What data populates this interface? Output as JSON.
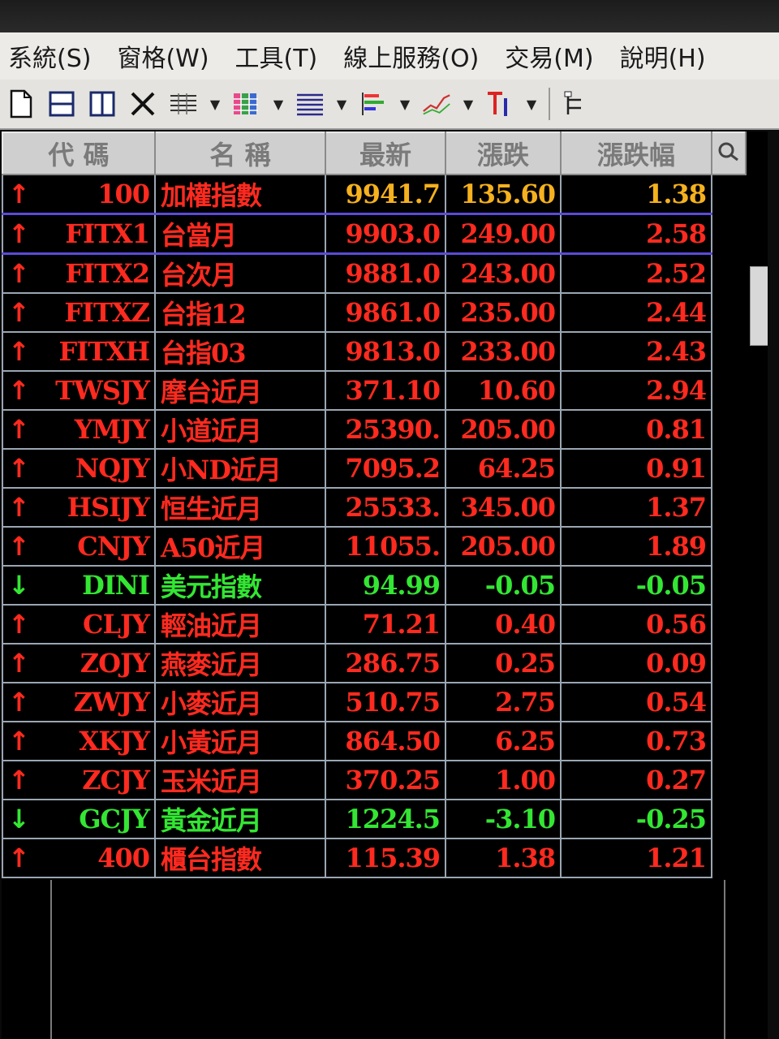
{
  "menu": [
    "系統(S)",
    "窗格(W)",
    "工具(T)",
    "線上服務(O)",
    "交易(M)",
    "說明(H)"
  ],
  "toolbar": {
    "buttons": [
      "new-doc-icon",
      "split-horizontal-icon",
      "split-vertical-icon",
      "close-x-icon",
      "table-grid-icon",
      "color-columns-icon",
      "list-rows-icon",
      "bar-chart-icon",
      "line-chart-icon",
      "text-format-icon",
      "tree-icon"
    ]
  },
  "table": {
    "headers": [
      "代 碼",
      "名 稱",
      "最新",
      "漲跌",
      "漲跌幅"
    ],
    "rows": [
      {
        "dir": "↑",
        "code": "100",
        "name": "加權指數",
        "last": "9941.7",
        "change": "135.60",
        "pct": "1.38",
        "color": "up",
        "lastColor": "yl",
        "changeColor": "yl",
        "pctColor": "yl"
      },
      {
        "dir": "↑",
        "code": "FITX1",
        "name": "台當月",
        "last": "9903.0",
        "change": "249.00",
        "pct": "2.58",
        "color": "up"
      },
      {
        "dir": "↑",
        "code": "FITX2",
        "name": "台次月",
        "last": "9881.0",
        "change": "243.00",
        "pct": "2.52",
        "color": "up"
      },
      {
        "dir": "↑",
        "code": "FITXZ",
        "name": "台指12",
        "last": "9861.0",
        "change": "235.00",
        "pct": "2.44",
        "color": "up"
      },
      {
        "dir": "↑",
        "code": "FITXH",
        "name": "台指03",
        "last": "9813.0",
        "change": "233.00",
        "pct": "2.43",
        "color": "up"
      },
      {
        "dir": "↑",
        "code": "TWSJY",
        "name": "摩台近月",
        "last": "371.10",
        "change": "10.60",
        "pct": "2.94",
        "color": "up"
      },
      {
        "dir": "↑",
        "code": "YMJY",
        "name": "小道近月",
        "last": "25390.",
        "change": "205.00",
        "pct": "0.81",
        "color": "up"
      },
      {
        "dir": "↑",
        "code": "NQJY",
        "name": "小ND近月",
        "last": "7095.2",
        "change": "64.25",
        "pct": "0.91",
        "color": "up"
      },
      {
        "dir": "↑",
        "code": "HSIJY",
        "name": "恒生近月",
        "last": "25533.",
        "change": "345.00",
        "pct": "1.37",
        "color": "up"
      },
      {
        "dir": "↑",
        "code": "CNJY",
        "name": "A50近月",
        "last": "11055.",
        "change": "205.00",
        "pct": "1.89",
        "color": "up"
      },
      {
        "dir": "↓",
        "code": "DINI",
        "name": "美元指數",
        "last": "94.99",
        "change": "-0.05",
        "pct": "-0.05",
        "color": "dn"
      },
      {
        "dir": "↑",
        "code": "CLJY",
        "name": "輕油近月",
        "last": "71.21",
        "change": "0.40",
        "pct": "0.56",
        "color": "up"
      },
      {
        "dir": "↑",
        "code": "ZOJY",
        "name": "燕麥近月",
        "last": "286.75",
        "change": "0.25",
        "pct": "0.09",
        "color": "up"
      },
      {
        "dir": "↑",
        "code": "ZWJY",
        "name": "小麥近月",
        "last": "510.75",
        "change": "2.75",
        "pct": "0.54",
        "color": "up"
      },
      {
        "dir": "↑",
        "code": "XKJY",
        "name": "小黃近月",
        "last": "864.50",
        "change": "6.25",
        "pct": "0.73",
        "color": "up"
      },
      {
        "dir": "↑",
        "code": "ZCJY",
        "name": "玉米近月",
        "last": "370.25",
        "change": "1.00",
        "pct": "0.27",
        "color": "up"
      },
      {
        "dir": "↓",
        "code": "GCJY",
        "name": "黃金近月",
        "last": "1224.5",
        "change": "-3.10",
        "pct": "-0.25",
        "color": "dn"
      },
      {
        "dir": "↑",
        "code": "400",
        "name": "櫃台指數",
        "last": "115.39",
        "change": "1.38",
        "pct": "1.21",
        "color": "up"
      }
    ]
  },
  "colors": {
    "up": "#ff2a1f",
    "down": "#33e633",
    "index": "#f5b11e",
    "selection": "#5a4bd6"
  }
}
